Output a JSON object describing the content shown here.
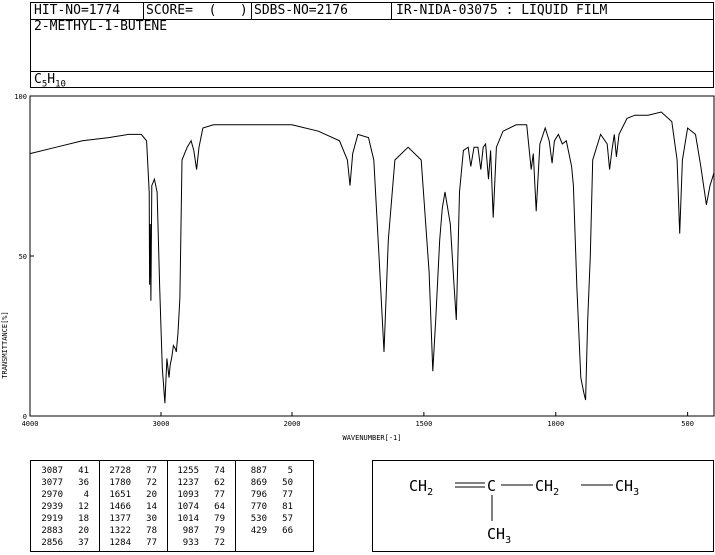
{
  "header": {
    "hit_no": "HIT-NO=1774",
    "score": "SCORE=  (   )",
    "sdbs_no": "SDBS-NO=2176",
    "ir_info": "IR-NIDA-03075 : LIQUID FILM",
    "compound_name": "2-METHYL-1-BUTENE",
    "formula_c": "C",
    "formula_c_sub": "5",
    "formula_h": "H",
    "formula_h_sub": "10"
  },
  "chart_data": {
    "type": "line",
    "title": "",
    "xlabel": "WAVENUMBER[-1]",
    "ylabel": "TRANSMITTANCE[%]",
    "xlim": [
      4000,
      400
    ],
    "ylim": [
      0,
      100
    ],
    "x_ticks": [
      4000,
      3000,
      2000,
      1500,
      1000,
      500
    ],
    "y_ticks": [
      0,
      50,
      100
    ],
    "grid": false,
    "series": [
      {
        "points": [
          [
            4000,
            82
          ],
          [
            3800,
            84
          ],
          [
            3600,
            86
          ],
          [
            3400,
            87
          ],
          [
            3250,
            88
          ],
          [
            3150,
            88
          ],
          [
            3110,
            86
          ],
          [
            3090,
            70
          ],
          [
            3087,
            41
          ],
          [
            3082,
            60
          ],
          [
            3077,
            36
          ],
          [
            3070,
            72
          ],
          [
            3050,
            74
          ],
          [
            3030,
            70
          ],
          [
            3010,
            40
          ],
          [
            2990,
            15
          ],
          [
            2970,
            4
          ],
          [
            2955,
            18
          ],
          [
            2939,
            12
          ],
          [
            2930,
            16
          ],
          [
            2919,
            18
          ],
          [
            2905,
            22
          ],
          [
            2890,
            21
          ],
          [
            2883,
            20
          ],
          [
            2870,
            26
          ],
          [
            2856,
            37
          ],
          [
            2840,
            80
          ],
          [
            2800,
            84
          ],
          [
            2770,
            86
          ],
          [
            2750,
            83
          ],
          [
            2728,
            77
          ],
          [
            2710,
            84
          ],
          [
            2680,
            90
          ],
          [
            2600,
            91
          ],
          [
            2400,
            91
          ],
          [
            2200,
            91
          ],
          [
            2000,
            91
          ],
          [
            1900,
            89
          ],
          [
            1820,
            86
          ],
          [
            1790,
            80
          ],
          [
            1780,
            72
          ],
          [
            1770,
            82
          ],
          [
            1750,
            88
          ],
          [
            1710,
            87
          ],
          [
            1690,
            80
          ],
          [
            1670,
            50
          ],
          [
            1651,
            20
          ],
          [
            1635,
            55
          ],
          [
            1610,
            80
          ],
          [
            1560,
            84
          ],
          [
            1510,
            80
          ],
          [
            1480,
            45
          ],
          [
            1466,
            14
          ],
          [
            1455,
            30
          ],
          [
            1440,
            55
          ],
          [
            1430,
            65
          ],
          [
            1420,
            70
          ],
          [
            1400,
            60
          ],
          [
            1385,
            40
          ],
          [
            1377,
            30
          ],
          [
            1365,
            70
          ],
          [
            1350,
            83
          ],
          [
            1332,
            84
          ],
          [
            1322,
            78
          ],
          [
            1310,
            84
          ],
          [
            1295,
            84
          ],
          [
            1284,
            77
          ],
          [
            1275,
            84
          ],
          [
            1266,
            85
          ],
          [
            1255,
            74
          ],
          [
            1247,
            83
          ],
          [
            1237,
            62
          ],
          [
            1225,
            84
          ],
          [
            1200,
            89
          ],
          [
            1150,
            91
          ],
          [
            1110,
            91
          ],
          [
            1093,
            77
          ],
          [
            1085,
            82
          ],
          [
            1074,
            64
          ],
          [
            1060,
            85
          ],
          [
            1040,
            90
          ],
          [
            1025,
            86
          ],
          [
            1014,
            79
          ],
          [
            1005,
            86
          ],
          [
            990,
            88
          ],
          [
            975,
            85
          ],
          [
            960,
            86
          ],
          [
            940,
            78
          ],
          [
            933,
            72
          ],
          [
            920,
            40
          ],
          [
            905,
            12
          ],
          [
            893,
            7
          ],
          [
            887,
            5
          ],
          [
            879,
            30
          ],
          [
            869,
            50
          ],
          [
            860,
            80
          ],
          [
            830,
            88
          ],
          [
            805,
            85
          ],
          [
            796,
            77
          ],
          [
            787,
            83
          ],
          [
            778,
            88
          ],
          [
            770,
            81
          ],
          [
            760,
            88
          ],
          [
            730,
            93
          ],
          [
            700,
            94
          ],
          [
            650,
            94
          ],
          [
            600,
            95
          ],
          [
            560,
            92
          ],
          [
            540,
            80
          ],
          [
            530,
            57
          ],
          [
            520,
            80
          ],
          [
            500,
            90
          ],
          [
            470,
            88
          ],
          [
            450,
            78
          ],
          [
            429,
            66
          ],
          [
            415,
            72
          ],
          [
            400,
            76
          ]
        ]
      }
    ]
  },
  "peak_table": [
    {
      "wavenumber": "3087",
      "t": "41"
    },
    {
      "wavenumber": "3077",
      "t": "36"
    },
    {
      "wavenumber": "2970",
      "t": "4"
    },
    {
      "wavenumber": "2939",
      "t": "12"
    },
    {
      "wavenumber": "2919",
      "t": "18"
    },
    {
      "wavenumber": "2883",
      "t": "20"
    },
    {
      "wavenumber": "2856",
      "t": "37"
    },
    {
      "wavenumber": "2728",
      "t": "77"
    },
    {
      "wavenumber": "1780",
      "t": "72"
    },
    {
      "wavenumber": "1651",
      "t": "20"
    },
    {
      "wavenumber": "1466",
      "t": "14"
    },
    {
      "wavenumber": "1377",
      "t": "30"
    },
    {
      "wavenumber": "1322",
      "t": "78"
    },
    {
      "wavenumber": "1284",
      "t": "77"
    },
    {
      "wavenumber": "1255",
      "t": "74"
    },
    {
      "wavenumber": "1237",
      "t": "62"
    },
    {
      "wavenumber": "1093",
      "t": "77"
    },
    {
      "wavenumber": "1074",
      "t": "64"
    },
    {
      "wavenumber": "1014",
      "t": "79"
    },
    {
      "wavenumber": "987",
      "t": "79"
    },
    {
      "wavenumber": "933",
      "t": "72"
    },
    {
      "wavenumber": "887",
      "t": "5"
    },
    {
      "wavenumber": "869",
      "t": "50"
    },
    {
      "wavenumber": "796",
      "t": "77"
    },
    {
      "wavenumber": "770",
      "t": "81"
    },
    {
      "wavenumber": "530",
      "t": "57"
    },
    {
      "wavenumber": "429",
      "t": "66"
    }
  ],
  "structure": {
    "ch2_left": "CH",
    "ch2_left_sub": "2",
    "c_center": "C",
    "ch2_mid": "CH",
    "ch2_mid_sub": "2",
    "ch3_right": "CH",
    "ch3_right_sub": "3",
    "ch3_bottom": "CH",
    "ch3_bottom_sub": "3"
  }
}
